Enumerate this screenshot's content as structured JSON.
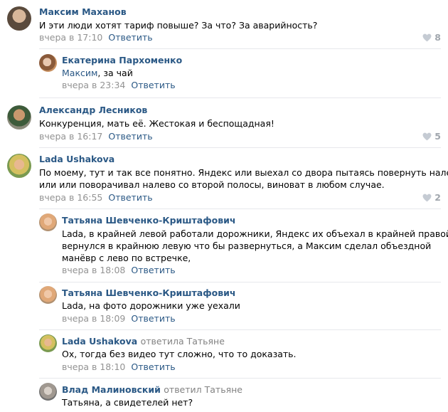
{
  "comments": [
    {
      "author": "Максим Маханов",
      "text": "И эти люди хотят тариф повыше? За что? За аварийность?",
      "time": "вчера в 17:10",
      "reply_label": "Ответить",
      "likes": "8"
    },
    {
      "author": "Екатерина Пархоменко",
      "mention": "Максим",
      "text_rest": ", за чай",
      "time": "вчера в 23:34",
      "reply_label": "Ответить"
    },
    {
      "author": "Александр Лесников",
      "text": "Конкуренция, мать её. Жестокая и беспощадная!",
      "time": "вчера в 16:17",
      "reply_label": "Ответить",
      "likes": "5"
    },
    {
      "author": "Lada Ushakova",
      "text_line1": "По моему, тут и так все понятно. Яндекс или выехал со двора пытаясь повернуть налево",
      "text_line2": "или или поворачивал налево со второй полосы, виноват в любом случае.",
      "time": "вчера в 16:55",
      "reply_label": "Ответить",
      "likes": "2"
    },
    {
      "author": "Татьяна Шевченко-Криштафович",
      "text_line1": "Lada, в крайней левой работали дорожники, Яндекс их объехал в крайней правой, и",
      "text_line2": "вернулся в крайнюю левую что бы развернуться, а Максим сделал объездной",
      "text_line3": "манёвр с лево по встречке,",
      "time": "вчера в 18:08",
      "reply_label": "Ответить"
    },
    {
      "author": "Татьяна Шевченко-Криштафович",
      "text": "Lada, на фото дорожники уже уехали",
      "time": "вчера в 18:09",
      "reply_label": "Ответить"
    },
    {
      "author": "Lada Ushakova",
      "replied": "ответила Татьяне",
      "text": "Ох, тогда без видео тут сложно, что то доказать.",
      "time": "вчера в 18:10",
      "reply_label": "Ответить"
    },
    {
      "author": "Влад Малиновский",
      "replied": "ответил Татьяне",
      "text": "Татьяна, а свидетелей нет?"
    }
  ]
}
